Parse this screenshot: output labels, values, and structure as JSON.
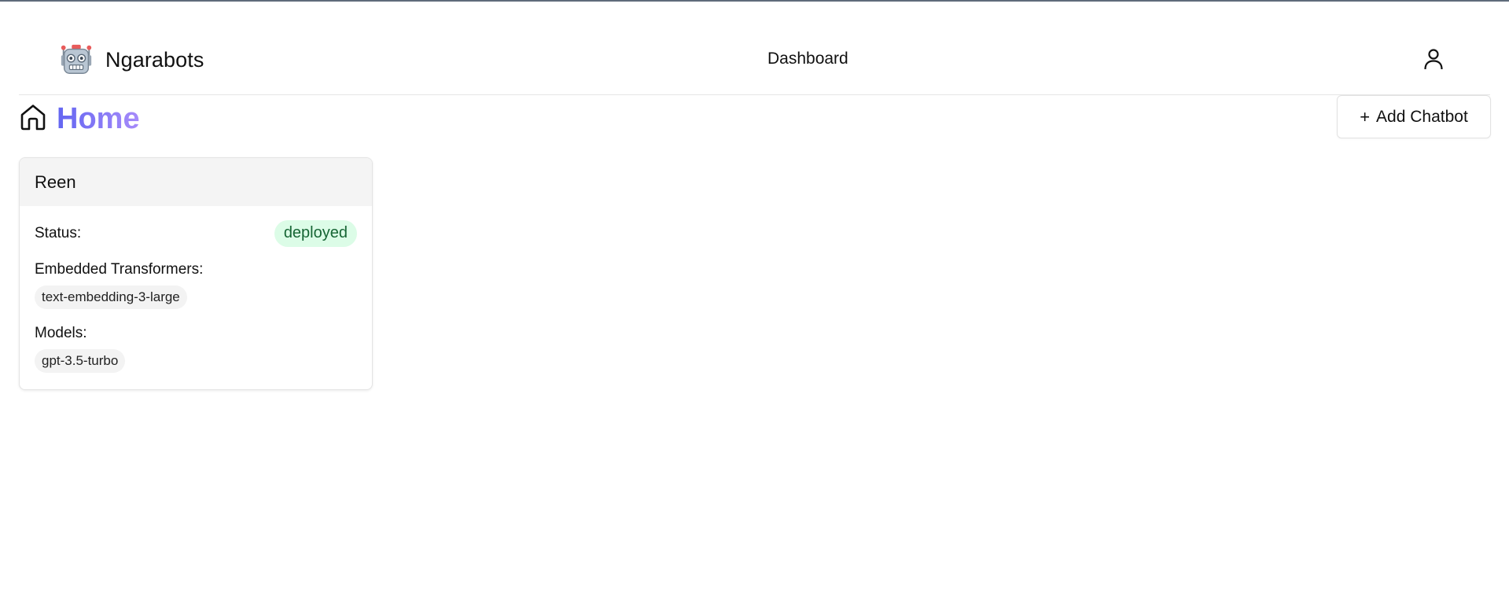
{
  "header": {
    "brand_name": "Ngarabots",
    "brand_icon": "robot-icon",
    "nav_dashboard": "Dashboard",
    "user_icon": "user-icon"
  },
  "page": {
    "title": "Home",
    "title_icon": "home-icon",
    "title_gradient": [
      "#6366f1",
      "#a78bfa"
    ],
    "add_button_label": "Add Chatbot",
    "add_button_icon": "plus-icon"
  },
  "chatbots": [
    {
      "name": "Reen",
      "status_label": "Status:",
      "status": "deployed",
      "status_color": "#166534",
      "status_bg": "#dcfce7",
      "embedded_label": "Embedded Transformers:",
      "embedded_transformers": [
        "text-embedding-3-large"
      ],
      "models_label": "Models:",
      "models": [
        "gpt-3.5-turbo"
      ]
    }
  ]
}
